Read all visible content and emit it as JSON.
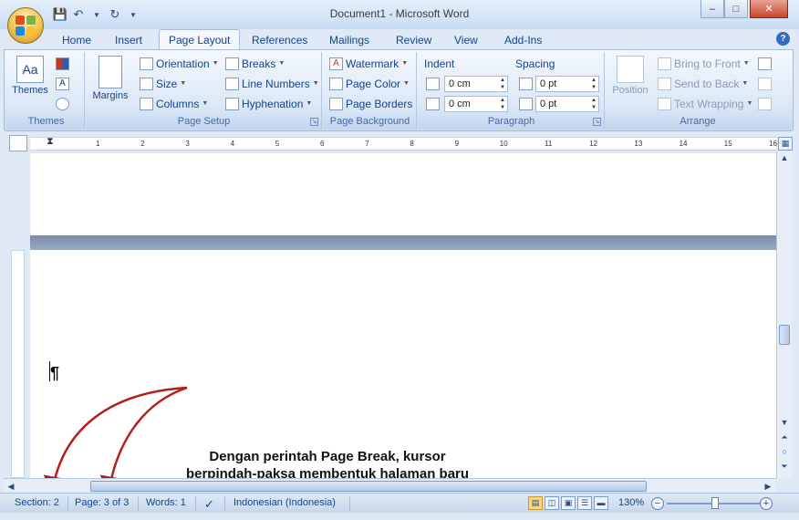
{
  "window": {
    "title": "Document1 - Microsoft Word",
    "minimize": "–",
    "maximize": "□",
    "close": "✕"
  },
  "tabs": [
    {
      "label": "Home"
    },
    {
      "label": "Insert"
    },
    {
      "label": "Page Layout"
    },
    {
      "label": "References"
    },
    {
      "label": "Mailings"
    },
    {
      "label": "Review"
    },
    {
      "label": "View"
    },
    {
      "label": "Add-Ins"
    }
  ],
  "ribbon": {
    "themes": {
      "themes_label": "Themes",
      "group_label": "Themes"
    },
    "page_setup": {
      "margins_label": "Margins",
      "orientation_label": "Orientation",
      "size_label": "Size",
      "columns_label": "Columns",
      "breaks_label": "Breaks",
      "line_numbers_label": "Line Numbers",
      "hyphenation_label": "Hyphenation",
      "group_label": "Page Setup"
    },
    "page_background": {
      "watermark_label": "Watermark",
      "page_color_label": "Page Color",
      "page_borders_label": "Page Borders",
      "group_label": "Page Background"
    },
    "paragraph": {
      "indent_label": "Indent",
      "spacing_label": "Spacing",
      "indent_left": "0 cm",
      "indent_right": "0 cm",
      "spacing_before": "0 pt",
      "spacing_after": "0 pt",
      "group_label": "Paragraph"
    },
    "arrange": {
      "position_label": "Position",
      "bring_front_label": "Bring to Front",
      "send_back_label": "Send to Back",
      "text_wrap_label": "Text Wrapping",
      "group_label": "Arrange"
    }
  },
  "ruler": {
    "ticks": [
      "1",
      "2",
      "3",
      "4",
      "5",
      "6",
      "7",
      "8",
      "9",
      "10",
      "11",
      "12",
      "13",
      "14",
      "15",
      "16"
    ]
  },
  "document": {
    "annotation": "Dengan perintah Page Break, kursor berpindah-paksa membentuk halaman baru namun masih dalam section yang sama dengan halaman sebelumnya",
    "pilcrow": "¶"
  },
  "statusbar": {
    "section": "Section: 2",
    "page": "Page: 3 of 3",
    "words": "Words: 1",
    "language": "Indonesian (Indonesia)",
    "zoom": "130%"
  },
  "colors": {
    "accent": "#15428b",
    "annotation_arrow": "#b71c1c"
  }
}
